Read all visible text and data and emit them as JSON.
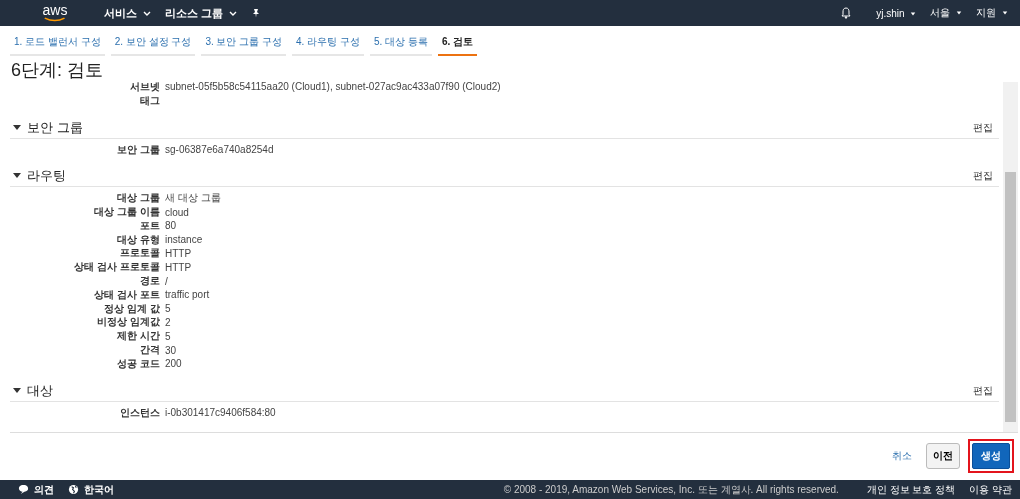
{
  "header": {
    "logo": "aws",
    "menus": [
      {
        "label": "서비스"
      },
      {
        "label": "리소스 그룹"
      }
    ],
    "right_menus": [
      {
        "label": "yj.shin"
      },
      {
        "label": "서울"
      },
      {
        "label": "지원"
      }
    ]
  },
  "steps": [
    {
      "label": "1. 로드 밸런서 구성",
      "selected": false
    },
    {
      "label": "2. 보안 설정 구성",
      "selected": false
    },
    {
      "label": "3. 보안 그룹 구성",
      "selected": false
    },
    {
      "label": "4. 라우팅 구성",
      "selected": false
    },
    {
      "label": "5. 대상 등록",
      "selected": false
    },
    {
      "label": "6. 검토",
      "selected": true
    }
  ],
  "page_title": "6단계: 검토",
  "top_rows": [
    {
      "label": "서브넷",
      "value": "subnet-05f5b58c54115aa20 (Cloud1), subnet-027ac9ac433a07f90 (Cloud2)"
    },
    {
      "label": "태그",
      "value": ""
    }
  ],
  "sections": [
    {
      "title": "보안 그룹",
      "edit": "편집",
      "rows": [
        {
          "label": "보안 그룹",
          "value": "sg-06387e6a740a8254d"
        }
      ]
    },
    {
      "title": "라우팅",
      "edit": "편집",
      "rows": [
        {
          "label": "대상 그룹",
          "value": "새 대상 그룹"
        },
        {
          "label": "대상 그룹 이름",
          "value": "cloud"
        },
        {
          "label": "포트",
          "value": "80"
        },
        {
          "label": "대상 유형",
          "value": "instance"
        },
        {
          "label": "프로토콜",
          "value": "HTTP"
        },
        {
          "label": "상태 검사 프로토콜",
          "value": "HTTP"
        },
        {
          "label": "경로",
          "value": "/"
        },
        {
          "label": "상태 검사 포트",
          "value": "traffic port"
        },
        {
          "label": "정상 임계 값",
          "value": "5"
        },
        {
          "label": "비정상 임계값",
          "value": "2"
        },
        {
          "label": "제한 시간",
          "value": "5"
        },
        {
          "label": "간격",
          "value": "30"
        },
        {
          "label": "성공 코드",
          "value": "200"
        }
      ]
    },
    {
      "title": "대상",
      "edit": "편집",
      "rows": [
        {
          "label": "인스턴스",
          "value": "i-0b301417c9406f584:80"
        }
      ]
    }
  ],
  "buttons": {
    "cancel": "취소",
    "previous": "이전",
    "create": "생성"
  },
  "footer": {
    "feedback": "의견",
    "language": "한국어",
    "copyright": "© 2008 - 2019, Amazon Web Services, Inc. 또는 계열사. All rights reserved.",
    "links": [
      "개인 정보 보호 정책",
      "이용 약관"
    ]
  }
}
